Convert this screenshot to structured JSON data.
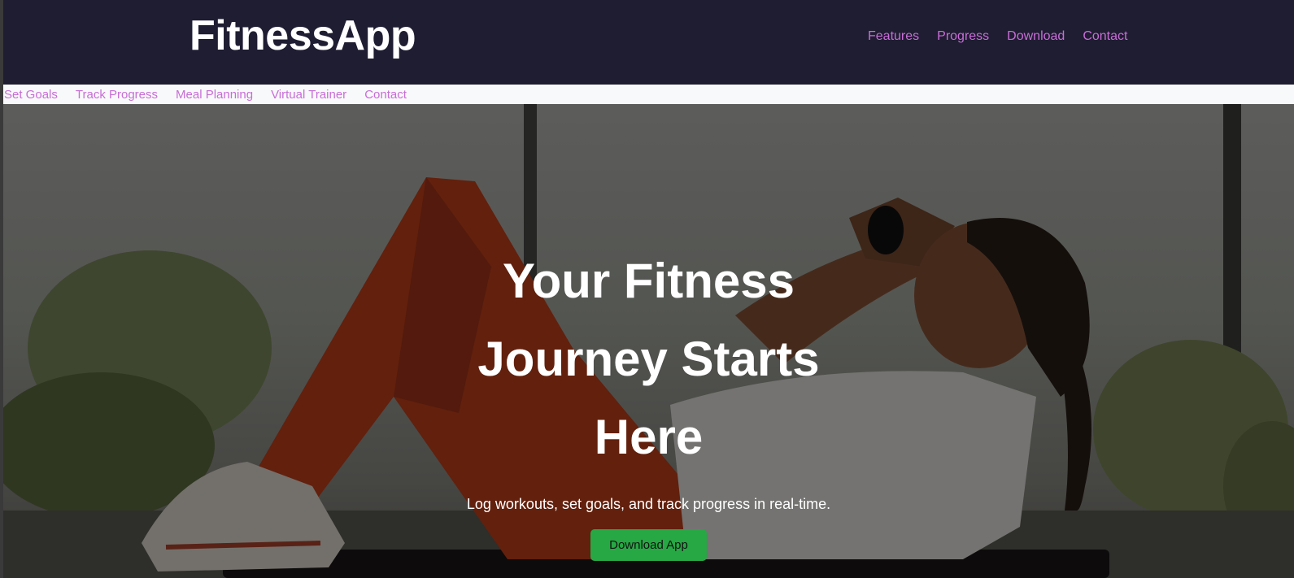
{
  "brand": {
    "name": "FitnessApp"
  },
  "top_nav": [
    "Features",
    "Progress",
    "Download",
    "Contact"
  ],
  "sub_nav": [
    "Set Goals",
    "Track Progress",
    "Meal Planning",
    "Virtual Trainer",
    "Contact"
  ],
  "hero": {
    "title": "Your Fitness Journey Starts Here",
    "subtitle": "Log workouts, set goals, and track progress in real-time.",
    "cta_label": "Download App",
    "background_image": "woman doing crunches on exercise mat"
  },
  "colors": {
    "header_bg": "#1f1d32",
    "nav_link": "#c86dd7",
    "subnav_bg": "#f8f9fa",
    "cta_bg": "#28a745",
    "hero_text": "#ffffff"
  }
}
